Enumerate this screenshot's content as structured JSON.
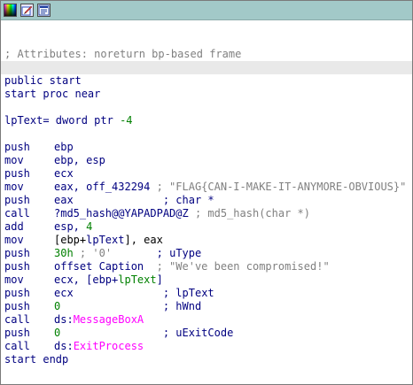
{
  "toolbar": {
    "icons": [
      "color-picker-icon",
      "edit-icon",
      "graph-view-icon"
    ]
  },
  "colors": {
    "titlebar": "#a2c9c8",
    "text": "#000080",
    "comment": "#808080",
    "number": "#008000",
    "import": "#ff00ff",
    "highlight": "#e9e9e9"
  },
  "code": {
    "attributes_comment": "; Attributes: noreturn bp-based frame",
    "public_start": "public start",
    "start_proc": "start proc near",
    "var_name": "lpText",
    "var_decl": "= dword ptr ",
    "var_offset": "-4",
    "l1": {
      "mnem": "push",
      "op": "ebp"
    },
    "l2": {
      "mnem": "mov",
      "op": "ebp, esp"
    },
    "l3": {
      "mnem": "push",
      "op": "ecx"
    },
    "l4": {
      "mnem": "mov",
      "op": "eax, off_432294",
      "comment": " ; \"FLAG{CAN-I-MAKE-IT-ANYMORE-OBVIOUS}\""
    },
    "l5": {
      "mnem": "push",
      "op": "eax",
      "pad": "              ",
      "comment": "; char *"
    },
    "l6": {
      "mnem": "call",
      "op": "?md5_hash@@YAPADPAD@Z",
      "comment": " ; md5_hash(char *)"
    },
    "l7": {
      "mnem": "add",
      "op_a": "esp, ",
      "num": "4"
    },
    "l8": {
      "mnem": "mov",
      "op_a": "[ebp+",
      "var": "lpText",
      "op_b": "], eax"
    },
    "l9": {
      "mnem": "push",
      "num": "30h",
      "pad": " ; ",
      "char": "'0'",
      "pad2": "       ",
      "comment": "; uType"
    },
    "l10": {
      "mnem": "push",
      "op": "offset Caption",
      "comment": "  ; \"We've been compromised!\""
    },
    "l11": {
      "mnem": "mov",
      "op_a": "ecx, [ebp+",
      "var": "lpText",
      "op_b": "]"
    },
    "l12": {
      "mnem": "push",
      "op": "ecx",
      "pad": "              ",
      "comment": "; lpText"
    },
    "l13": {
      "mnem": "push",
      "num": "0",
      "pad": "                ",
      "comment": "; hWnd"
    },
    "l14": {
      "mnem": "call",
      "op_a": "ds:",
      "imp": "MessageBoxA"
    },
    "l15": {
      "mnem": "push",
      "num": "0",
      "pad": "                ",
      "comment": "; uExitCode"
    },
    "l16": {
      "mnem": "call",
      "op_a": "ds:",
      "imp": "ExitProcess"
    },
    "endp": "start endp"
  }
}
